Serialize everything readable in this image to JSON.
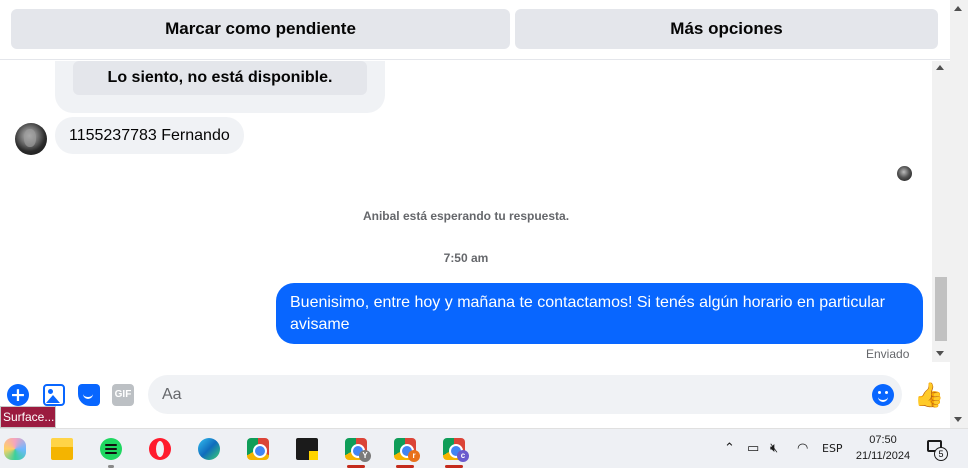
{
  "top_actions": {
    "pending_label": "Marcar como pendiente",
    "more_label": "Más opciones"
  },
  "chat": {
    "card_button": "Lo siento, no está disponible.",
    "incoming_message": "1155237783 Fernando",
    "waiting_status": "Anibal está esperando tu respuesta.",
    "timestamp": "7:50 am",
    "outgoing_message": "Buenisimo, entre hoy y mañana te contactamos! Si tenés algún horario en particular avisame",
    "sent_status": "Enviado"
  },
  "composer": {
    "placeholder": "Aa",
    "gif_label": "GIF",
    "like_icon": "thumbs-up-icon"
  },
  "surface_tab": "Surface...",
  "taskbar": {
    "apps": [
      "copilot",
      "file-explorer",
      "spotify",
      "opera",
      "edge",
      "chrome",
      "stickies",
      "chrome-profile-y",
      "chrome-profile-r",
      "chrome-profile-c"
    ],
    "chrome_badges": [
      "Y",
      "r",
      "c"
    ],
    "tray": {
      "language": "ESP",
      "time": "07:50",
      "date": "21/11/2024",
      "notification_count": "5"
    }
  },
  "colors": {
    "accent": "#0866ff",
    "bubble_gray": "#f0f2f5",
    "button_gray": "#e4e6eb",
    "secondary_text": "#65676b"
  }
}
